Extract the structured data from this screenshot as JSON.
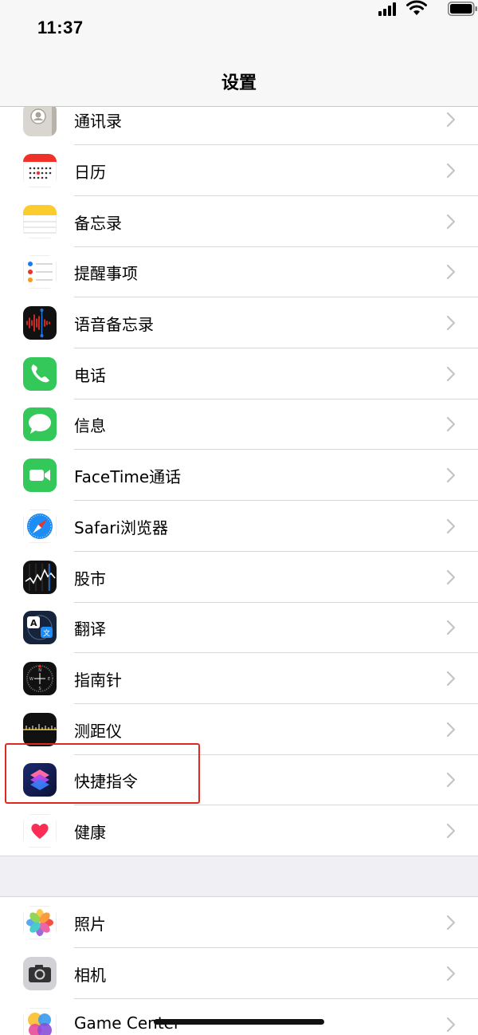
{
  "status_bar": {
    "time": "11:37"
  },
  "nav": {
    "title": "设置"
  },
  "group1": [
    {
      "id": "contacts",
      "label": "通讯录",
      "icon": "contacts-icon"
    },
    {
      "id": "calendar",
      "label": "日历",
      "icon": "calendar-icon"
    },
    {
      "id": "notes",
      "label": "备忘录",
      "icon": "notes-icon"
    },
    {
      "id": "reminders",
      "label": "提醒事项",
      "icon": "reminders-icon"
    },
    {
      "id": "voice-memos",
      "label": "语音备忘录",
      "icon": "voice-memos-icon"
    },
    {
      "id": "phone",
      "label": "电话",
      "icon": "phone-icon"
    },
    {
      "id": "messages",
      "label": "信息",
      "icon": "messages-icon"
    },
    {
      "id": "facetime",
      "label": "FaceTime通话",
      "icon": "facetime-icon"
    },
    {
      "id": "safari",
      "label": "Safari浏览器",
      "icon": "safari-icon"
    },
    {
      "id": "stocks",
      "label": "股市",
      "icon": "stocks-icon"
    },
    {
      "id": "translate",
      "label": "翻译",
      "icon": "translate-icon"
    },
    {
      "id": "compass",
      "label": "指南针",
      "icon": "compass-icon"
    },
    {
      "id": "measure",
      "label": "测距仪",
      "icon": "measure-icon"
    },
    {
      "id": "shortcuts",
      "label": "快捷指令",
      "icon": "shortcuts-icon"
    },
    {
      "id": "health",
      "label": "健康",
      "icon": "health-icon"
    }
  ],
  "group2": [
    {
      "id": "photos",
      "label": "照片",
      "icon": "photos-icon"
    },
    {
      "id": "camera",
      "label": "相机",
      "icon": "camera-icon"
    },
    {
      "id": "game-center",
      "label": "Game Center",
      "icon": "game-center-icon"
    }
  ],
  "highlighted_item": "快捷指令",
  "colors": {
    "highlight_border": "#e0281e",
    "group_gap": "#efeff4",
    "chevron": "#c4c4c8"
  }
}
